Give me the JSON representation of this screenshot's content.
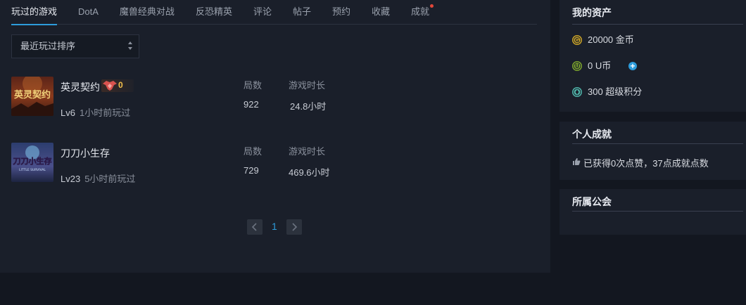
{
  "tabs": [
    {
      "label": "玩过的游戏",
      "active": true
    },
    {
      "label": "DotA"
    },
    {
      "label": "魔兽经典对战"
    },
    {
      "label": "反恐精英"
    },
    {
      "label": "评论"
    },
    {
      "label": "帖子"
    },
    {
      "label": "预约"
    },
    {
      "label": "收藏"
    },
    {
      "label": "成就",
      "has_notification_dot": true
    }
  ],
  "sort": {
    "selected": "最近玩过排序"
  },
  "games": [
    {
      "name": "英灵契约",
      "cover_text": "英灵契约",
      "badge_count": "0",
      "level": "Lv6",
      "last_played": "1小时前玩过",
      "rounds_label": "局数",
      "rounds": "922",
      "time_label": "游戏时长",
      "time": "24.8小时"
    },
    {
      "name": "刀刀小生存",
      "cover_text": "刀刀小生存",
      "cover_subtext": "LITTLE SURVIVAL",
      "level": "Lv23",
      "last_played": "5小时前玩过",
      "rounds_label": "局数",
      "rounds": "729",
      "time_label": "游戏时长",
      "time": "469.6小时"
    }
  ],
  "pagination": {
    "current": "1"
  },
  "assets": {
    "title": "我的资产",
    "gold": {
      "icon": "gold-coin-icon",
      "icon_letter": "G",
      "text": "20000 金币",
      "color": "#c9a227"
    },
    "ucoin": {
      "icon": "u-coin-icon",
      "icon_letter": "U",
      "text": "0 U币",
      "color": "#7aa22d"
    },
    "points": {
      "icon": "super-points-icon",
      "text": "300 超级积分",
      "color": "#4fb3a8"
    }
  },
  "achievements": {
    "title": "个人成就",
    "text": "已获得0次点赞，37点成就点数"
  },
  "guild": {
    "title": "所属公会"
  },
  "colors": {
    "accent": "#2d9cdb",
    "notification": "#e2463a",
    "badge_text": "#f4c14a"
  }
}
